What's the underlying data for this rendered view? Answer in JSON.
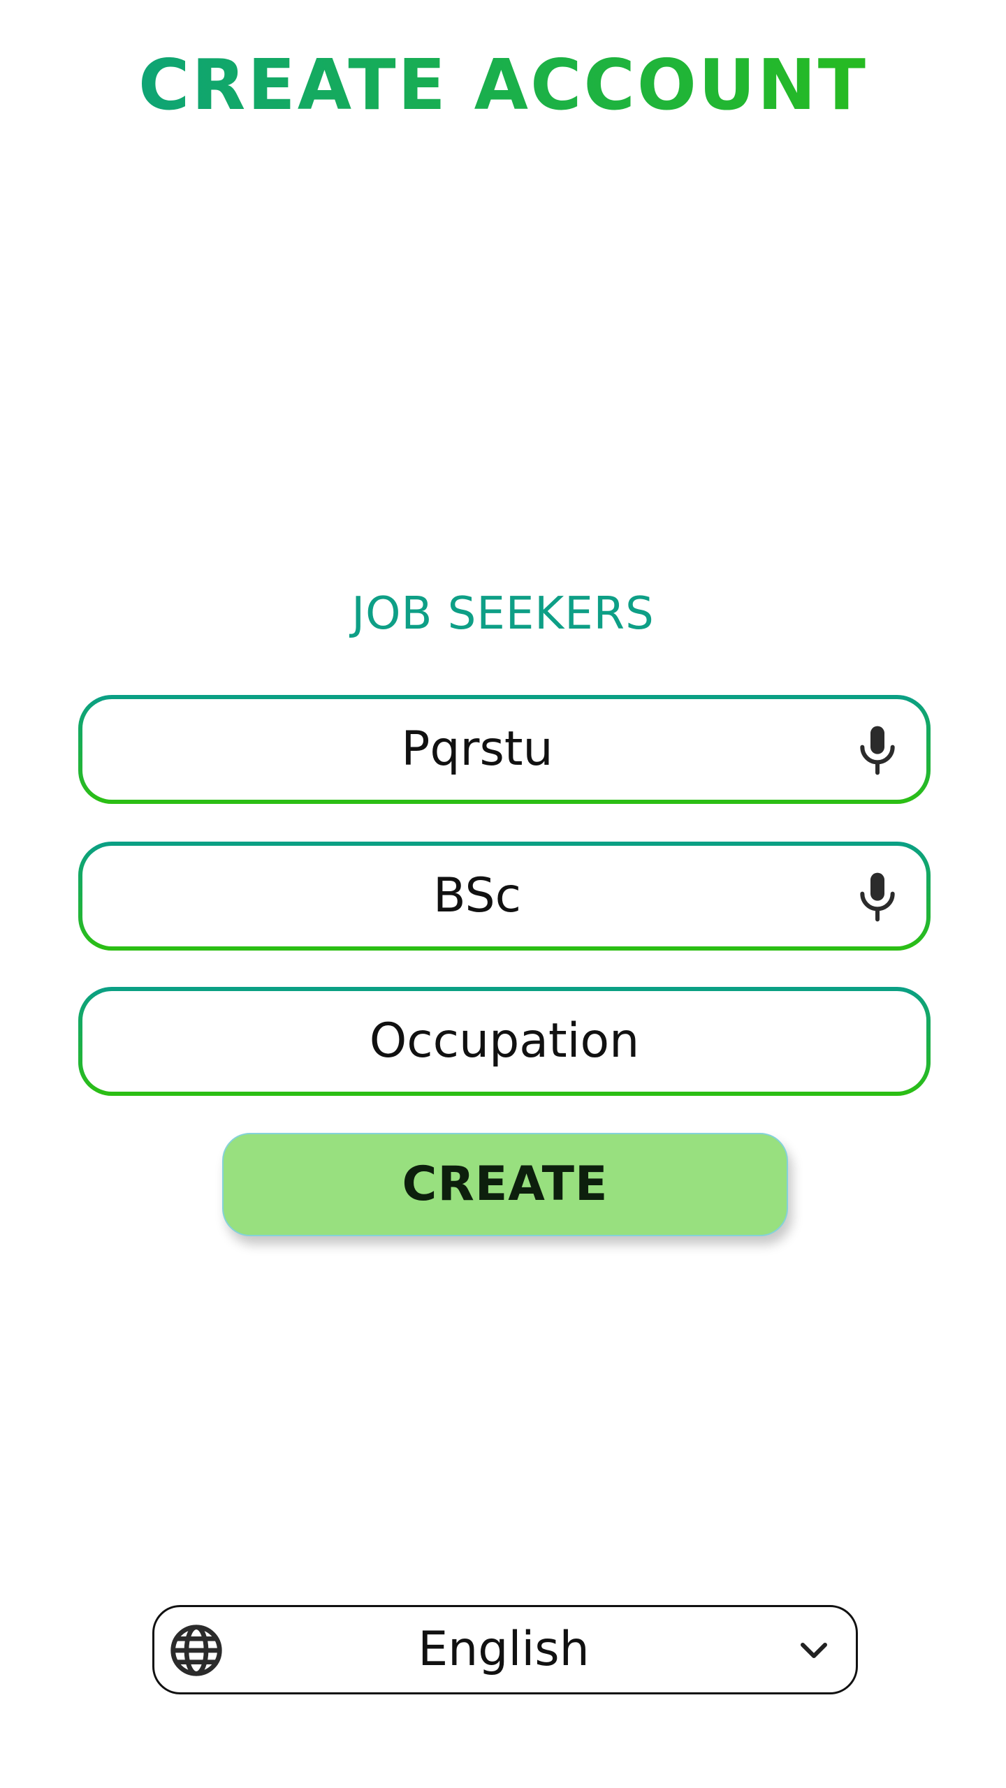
{
  "header": {
    "title": "CREATE ACCOUNT"
  },
  "form": {
    "section_label": "JOB SEEKERS",
    "fields": [
      {
        "value": "Pqrstu",
        "icon": "microphone-icon"
      },
      {
        "value": "BSc",
        "icon": "microphone-icon"
      },
      {
        "placeholder": "Occupation"
      }
    ],
    "submit_label": "CREATE"
  },
  "language_selector": {
    "selected": "English",
    "icons": [
      "globe-icon",
      "chevron-down-icon"
    ]
  },
  "colors": {
    "accent_teal": "#0aa084",
    "accent_green": "#2bbf12",
    "button_fill": "#98e07f"
  }
}
